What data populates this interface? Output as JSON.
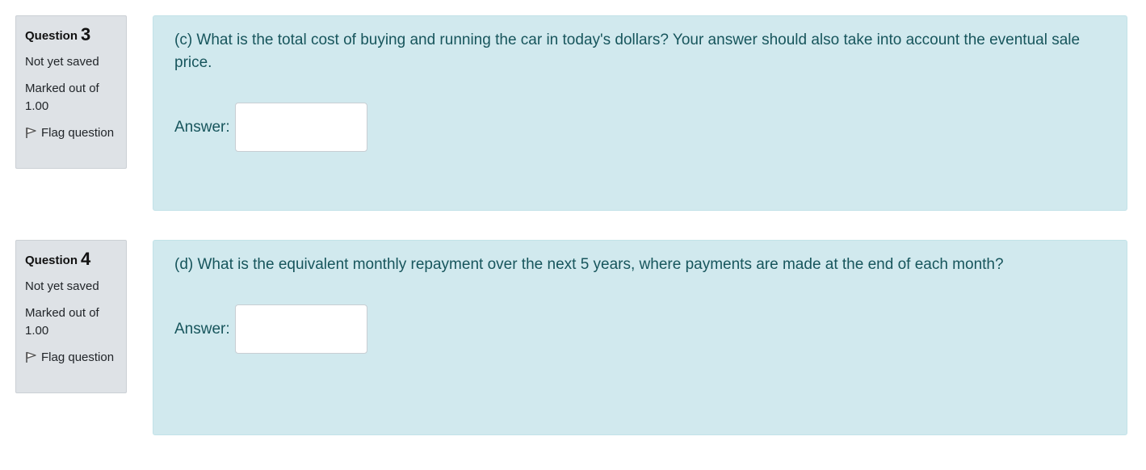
{
  "questions": [
    {
      "label": "Question",
      "number": "3",
      "state": "Not yet saved",
      "grade": "Marked out of 1.00",
      "flag_label": "Flag question",
      "text": "(c) What is the total cost of buying and running the car in today's dollars? Your answer should also take into account the eventual sale price.",
      "answer_label": "Answer:",
      "answer_value": ""
    },
    {
      "label": "Question",
      "number": "4",
      "state": "Not yet saved",
      "grade": "Marked out of 1.00",
      "flag_label": "Flag question",
      "text": "(d) What is the equivalent monthly repayment over the next 5 years, where payments are made at the end of each month?",
      "answer_label": "Answer:",
      "answer_value": ""
    }
  ],
  "colors": {
    "info_bg": "#dee2e6",
    "content_bg": "#d1e9ee",
    "content_text": "#17555c"
  },
  "icons": {
    "flag": "flag-icon"
  }
}
